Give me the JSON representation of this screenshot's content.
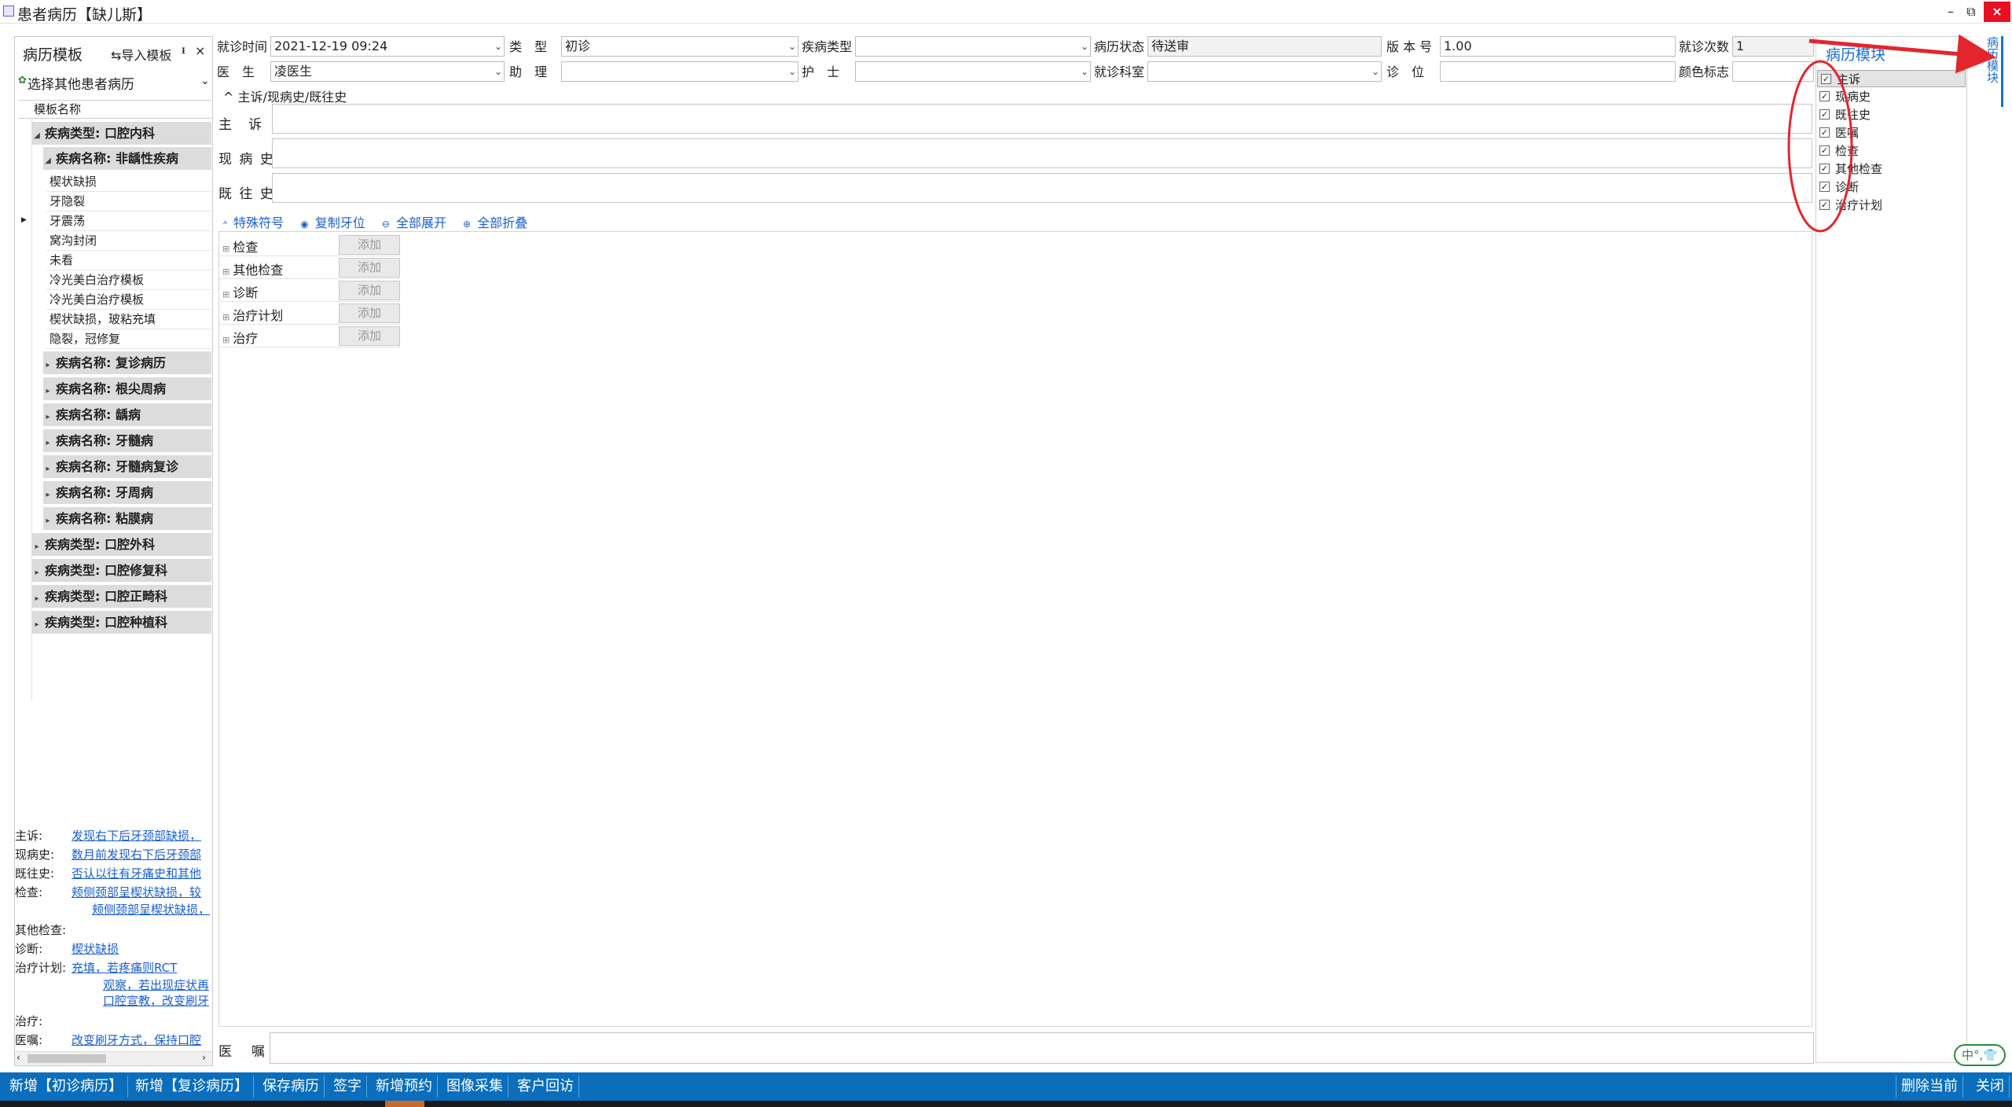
{
  "window": {
    "title": "患者病历【缺儿斯】",
    "minimize": "–",
    "restore": "⧉",
    "close": "×"
  },
  "left_panel": {
    "title": "病历模板",
    "import_label": "导入模板",
    "pin": "ᵻ",
    "close": "×",
    "select_other": "选择其他患者病历",
    "column_header": "模板名称",
    "tree": {
      "group1": "疾病类型: 口腔内科",
      "sub1": "疾病名称: 非龋性疾病",
      "leaves": [
        "楔状缺损",
        "牙隐裂",
        "牙震荡",
        "窝沟封闭",
        "未看",
        "冷光美白治疗模板",
        "冷光美白治疗模板",
        "楔状缺损，玻粘充填",
        "隐裂，冠修复"
      ],
      "subs": [
        "疾病名称: 复诊病历",
        "疾病名称: 根尖周病",
        "疾病名称: 龋病",
        "疾病名称: 牙髓病",
        "疾病名称: 牙髓病复诊",
        "疾病名称: 牙周病",
        "疾病名称: 粘膜病"
      ],
      "groups": [
        "疾病类型: 口腔外科",
        "疾病类型: 口腔修复科",
        "疾病类型: 口腔正畸科",
        "疾病类型: 口腔种植科"
      ]
    },
    "summary": {
      "rows": [
        {
          "k": "主诉:",
          "v": "发现右下后牙颈部缺损，"
        },
        {
          "k": "现病史:",
          "v": "数月前发现右下后牙颈部"
        },
        {
          "k": "既往史:",
          "v": "否认以往有牙痛史和其他"
        },
        {
          "k": "检查:",
          "v": "颊侧颈部呈楔状缺损，较"
        },
        {
          "k": "其他检查:",
          "v": ""
        },
        {
          "k": "诊断:",
          "v": "楔状缺损"
        },
        {
          "k": "治疗计划:",
          "v": "充填，若疼痛则RCT"
        },
        {
          "k": "治疗:",
          "v": ""
        },
        {
          "k": "医嘱:",
          "v": "改变刷牙方式，保持口腔"
        }
      ],
      "check_cont": "颊侧颈部呈楔状缺损，",
      "plan_cont1": "观察，若出现症状再",
      "plan_cont2": "口腔宣教，改变刷牙"
    }
  },
  "form": {
    "visit_time_label": "就诊时间",
    "visit_time": "2021-12-19 09:24",
    "type_label": "类　型",
    "type": "初诊",
    "disease_type_label": "疾病类型",
    "disease_type": "",
    "status_label": "病历状态",
    "status": "待送审",
    "version_label": "版 本 号",
    "version": "1.00",
    "visit_count_label": "就诊次数",
    "visit_count": "1",
    "doctor_label": "医　生",
    "doctor": "凌医生",
    "assistant_label": "助　理",
    "assistant": "",
    "nurse_label": "护　士",
    "nurse": "",
    "dept_label": "就诊科室",
    "dept": "",
    "chair_label": "诊　位",
    "chair": "",
    "color_label": "颜色标志",
    "color": ""
  },
  "section": {
    "title": "主诉/现病史/既往史",
    "chief": "主　诉",
    "present": "现 病 史",
    "past": "既 往 史"
  },
  "tools": {
    "special": "特殊符号",
    "copy_tooth": "复制牙位",
    "expand": "全部展开",
    "collapse": "全部折叠"
  },
  "grid": {
    "add": "添加",
    "rows": [
      "检查",
      "其他检查",
      "诊断",
      "治疗计划",
      "治疗"
    ]
  },
  "order_label": "医　嘱",
  "right_panel": {
    "title": "病历模块",
    "items": [
      "主诉",
      "现病史",
      "既往史",
      "医嘱",
      "检查",
      "其他检查",
      "诊断",
      "治疗计划"
    ]
  },
  "side_tab": "病历模块",
  "ime": "中°,👕",
  "bottom": {
    "left": [
      "新增【初诊病历】",
      "新增【复诊病历】",
      "保存病历",
      "签字",
      "新增预约",
      "图像采集",
      "客户回访"
    ],
    "right": [
      "删除当前",
      "关闭"
    ]
  },
  "colors": {
    "accent": "#0a6ebd",
    "link": "#1a5fd0",
    "annotation": "#e3262e"
  }
}
